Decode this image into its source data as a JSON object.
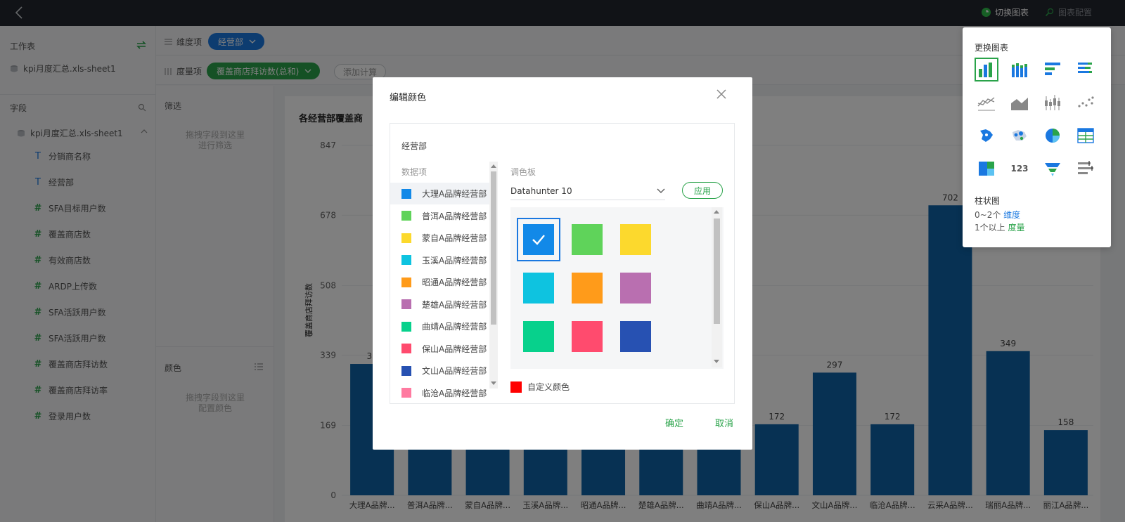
{
  "topbar": {
    "switch_chart": "切换图表",
    "chart_config": "图表配置"
  },
  "left": {
    "worksheet_title": "工作表",
    "file_name": "kpi月度汇总.xls-sheet1",
    "fields_title": "字段",
    "tree_name": "kpi月度汇总.xls-sheet1",
    "fields": [
      {
        "type": "T",
        "label": "分销商名称"
      },
      {
        "type": "T",
        "label": "经营部"
      },
      {
        "type": "#",
        "label": "SFA目标用户数"
      },
      {
        "type": "#",
        "label": "覆盖商店数"
      },
      {
        "type": "#",
        "label": "有效商店数"
      },
      {
        "type": "#",
        "label": "ARDP上传数"
      },
      {
        "type": "#",
        "label": "SFA活跃用户数"
      },
      {
        "type": "#",
        "label": "SFA活跃用户数"
      },
      {
        "type": "#",
        "label": "覆盖商店拜访数"
      },
      {
        "type": "#",
        "label": "覆盖商店拜访率"
      },
      {
        "type": "#",
        "label": "登录用户数"
      }
    ]
  },
  "shelf": {
    "dimension_label": "维度项",
    "dimension_pill": "经营部",
    "measure_label": "度量项",
    "measure_pill": "覆盖商店拜访数(总和)",
    "add_calc": "添加计算"
  },
  "config": {
    "filter_title": "筛选",
    "filter_hint_1": "拖拽字段到这里",
    "filter_hint_2": "进行筛选",
    "color_title": "颜色",
    "color_hint_1": "拖拽字段到这里",
    "color_hint_2": "配置颜色"
  },
  "chart_title": "各经营部覆盖商",
  "chart_data": {
    "type": "bar",
    "title": "各经营部覆盖商",
    "ylabel": "覆盖商店拜访数",
    "yticks": [
      "847",
      "678",
      "508",
      "339",
      "169",
      "0"
    ],
    "ylim": [
      0,
      847
    ],
    "categories": [
      "大理A品牌...",
      "普洱A品牌...",
      "蒙自A品牌...",
      "玉溪A品牌...",
      "昭通A品牌...",
      "楚雄A品牌...",
      "曲靖A品牌...",
      "保山A品牌...",
      "文山A品牌...",
      "临沧A品牌...",
      "云采A品牌...",
      "瑞丽A品牌...",
      "丽江A品牌..."
    ],
    "values": [
      318,
      210,
      180,
      200,
      220,
      190,
      250,
      172,
      297,
      172,
      702,
      349,
      158
    ],
    "labels": [
      "31",
      "",
      "",
      "",
      "",
      "",
      "",
      "172",
      "297",
      "172",
      "702",
      "349",
      "158"
    ],
    "color": "#0e62a6",
    "grid": true
  },
  "popover": {
    "title": "更换图表",
    "icons": [
      "bar-chart-icon",
      "stacked-bar-icon",
      "horizontal-bar-icon",
      "stacked-horizontal-bar-icon",
      "line-chart-icon",
      "area-chart-icon",
      "candlestick-icon",
      "scatter-icon",
      "map-icon",
      "bubble-map-icon",
      "pie-chart-icon",
      "table-icon",
      "treemap-icon",
      "kpi-number-icon",
      "funnel-icon",
      "bullet-icon"
    ],
    "kpi_text": "123",
    "chart_name": "柱状图",
    "dim_rule_pre": "0~2个 ",
    "dim_rule_acc": "维度",
    "measure_rule_pre": "1个以上 ",
    "measure_rule_acc": "度量"
  },
  "dialog": {
    "title": "编辑颜色",
    "field": "经营部",
    "items_head": "数据项",
    "palette_head": "调色板",
    "items": [
      {
        "label": "大理A品牌经营部",
        "color": "#1289e8"
      },
      {
        "label": "普洱A品牌经营部",
        "color": "#5fd35a"
      },
      {
        "label": "蒙自A品牌经营部",
        "color": "#fcd92d"
      },
      {
        "label": "玉溪A品牌经营部",
        "color": "#0ec3e0"
      },
      {
        "label": "昭通A品牌经营部",
        "color": "#ff9b1a"
      },
      {
        "label": "楚雄A品牌经营部",
        "color": "#b96fb0"
      },
      {
        "label": "曲靖A品牌经营部",
        "color": "#07d18c"
      },
      {
        "label": "保山A品牌经营部",
        "color": "#ff4b6e"
      },
      {
        "label": "文山A品牌经营部",
        "color": "#2751b2"
      },
      {
        "label": "临沧A品牌经营部",
        "color": "#ff7aa0"
      }
    ],
    "palette_name": "Datahunter 10",
    "apply": "应用",
    "swatches": [
      "#1289e8",
      "#5fd35a",
      "#fcd92d",
      "#0ec3e0",
      "#ff9b1a",
      "#b96fb0",
      "#07d18c",
      "#ff4b6e",
      "#2751b2"
    ],
    "custom_label": "自定义颜色",
    "custom_color": "#ff0000",
    "ok": "确定",
    "cancel": "取消"
  }
}
